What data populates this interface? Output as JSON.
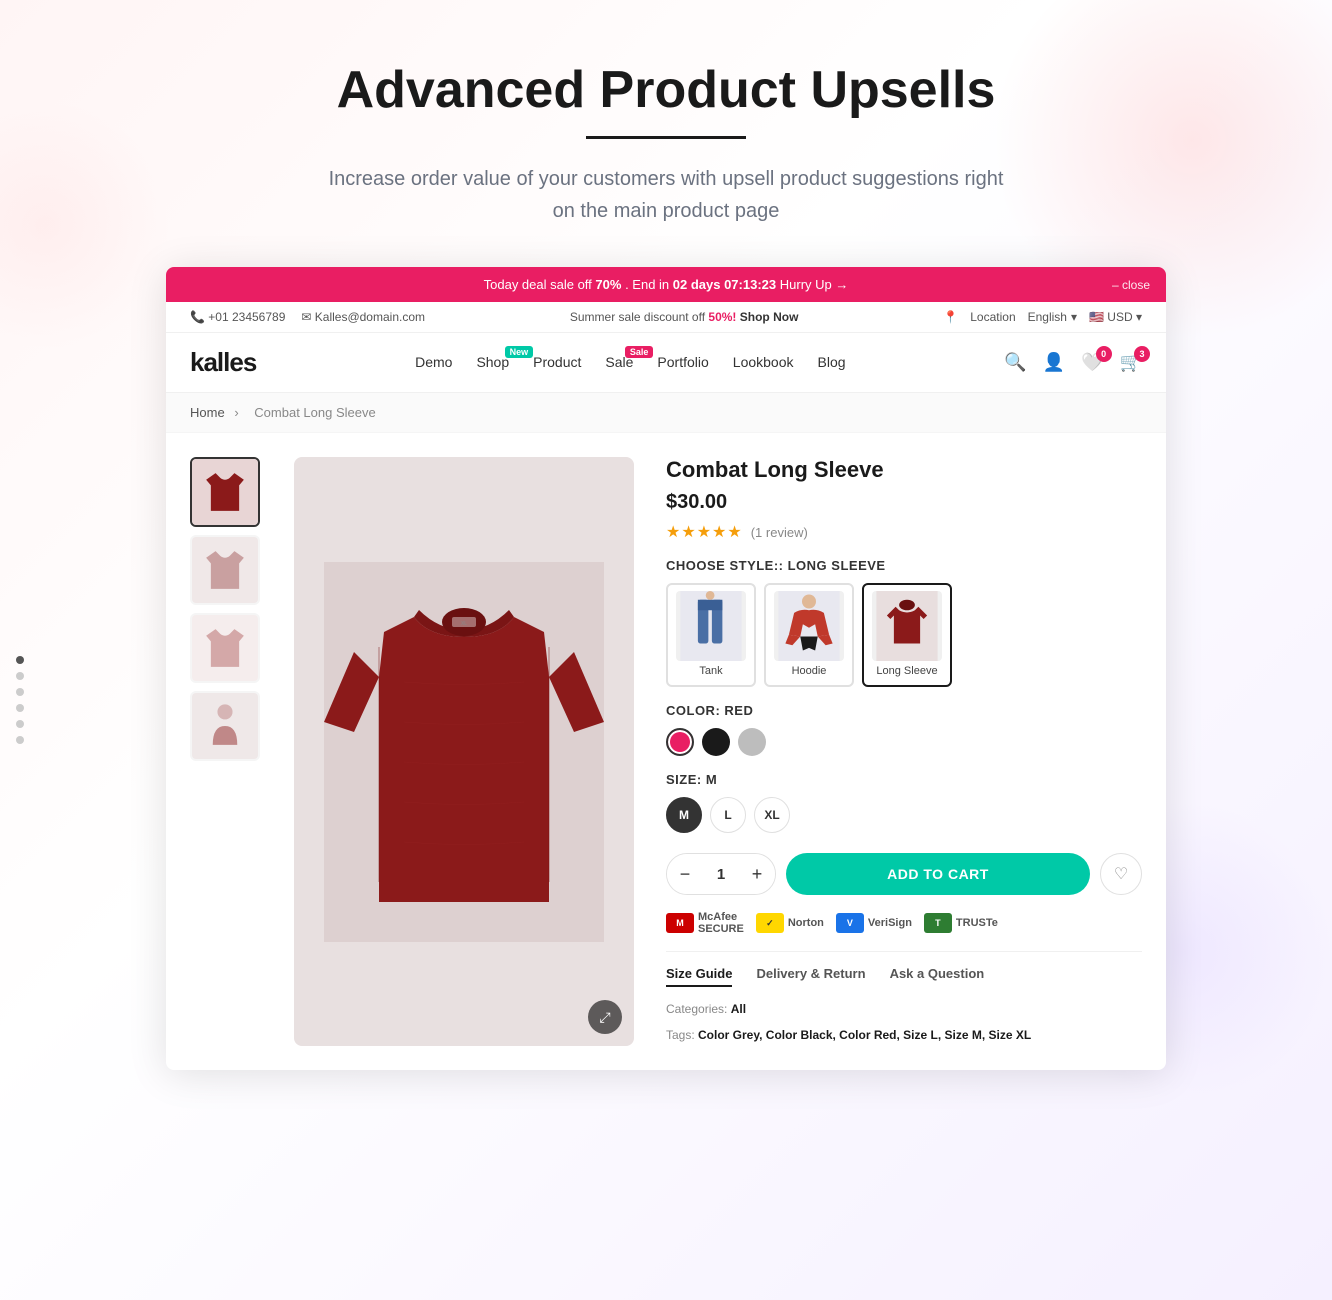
{
  "hero": {
    "title": "Advanced Product Upsells",
    "subtitle": "Increase order value of your customers with upsell product suggestions right on the main product page"
  },
  "announcement": {
    "text": "Today deal sale off ",
    "bold1": "70%",
    "text2": " . End in ",
    "bold2": "02 days 07:13:23",
    "text3": " Hurry Up →",
    "close": "– close"
  },
  "infobar": {
    "phone": "+01 23456789",
    "email": "Kalles@domain.com",
    "promo": "Summer sale discount off ",
    "promo_pct": "50%!",
    "shop_now": "Shop Now",
    "location": "Location",
    "language": "English",
    "currency": "USD"
  },
  "nav": {
    "logo": "kalles",
    "links": [
      "Demo",
      "Shop",
      "Product",
      "Sale",
      "Portfolio",
      "Lookbook",
      "Blog"
    ],
    "badges": {
      "Shop": "New",
      "Sale": "Sale"
    },
    "cart_count": "3",
    "wishlist_count": "0"
  },
  "breadcrumb": {
    "home": "Home",
    "current": "Combat Long Sleeve"
  },
  "product": {
    "name": "Combat Long Sleeve",
    "price": "$30.00",
    "rating": "★★★★★",
    "review_count": "(1 review)",
    "style_label": "CHOOSE STYLE:: LONG SLEEVE",
    "styles": [
      "Tank",
      "Hoodie",
      "Long Sleeve"
    ],
    "active_style": "Long Sleeve",
    "color_label": "COLOR: RED",
    "colors": [
      "#e91e63",
      "#1a1a1a",
      "#bdbdbd"
    ],
    "active_color": "#e91e63",
    "size_label": "SIZE: M",
    "sizes": [
      "M",
      "L",
      "XL"
    ],
    "active_size": "M",
    "quantity": "1",
    "add_to_cart": "ADD TO CART",
    "tabs": [
      "Size Guide",
      "Delivery & Return",
      "Ask a Question"
    ],
    "categories": "All",
    "tags": "Color Grey, Color Black, Color Red, Size L, Size M, Size XL"
  },
  "trust": [
    {
      "name": "McAfee SECURE",
      "abbr": "McAfee"
    },
    {
      "name": "Norton",
      "abbr": "Norton"
    },
    {
      "name": "VeriSign",
      "abbr": "Veri Sign"
    },
    {
      "name": "TRUSTe",
      "abbr": "TRUSTe"
    }
  ],
  "dots": 6
}
